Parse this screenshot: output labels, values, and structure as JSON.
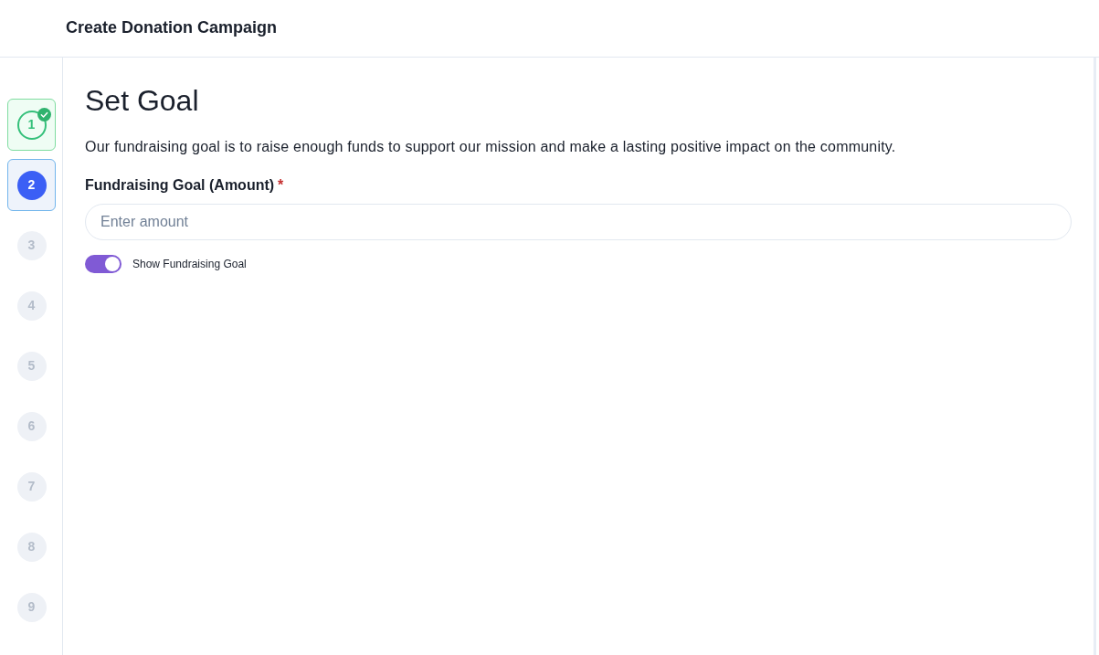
{
  "header": {
    "title": "Create Donation Campaign"
  },
  "steps": [
    {
      "label": "1",
      "selected": false,
      "completed": true
    },
    {
      "label": "2",
      "selected": true,
      "completed": false
    },
    {
      "label": "3",
      "selected": false,
      "completed": false
    },
    {
      "label": "4",
      "selected": false,
      "completed": false
    },
    {
      "label": "5",
      "selected": false,
      "completed": false
    },
    {
      "label": "6",
      "selected": false,
      "completed": false
    },
    {
      "label": "7",
      "selected": false,
      "completed": false
    },
    {
      "label": "8",
      "selected": false,
      "completed": false
    },
    {
      "label": "9",
      "selected": false,
      "completed": false
    }
  ],
  "section": {
    "title": "Set Goal",
    "description": "Our fundraising goal is to raise enough funds to support our mission and make a lasting positive impact on the community.",
    "field": {
      "label": "Fundraising Goal (Amount)",
      "required_mark": "*",
      "placeholder": "Enter amount"
    },
    "toggle": {
      "label": "Show Fundraising Goal",
      "on": true
    }
  }
}
